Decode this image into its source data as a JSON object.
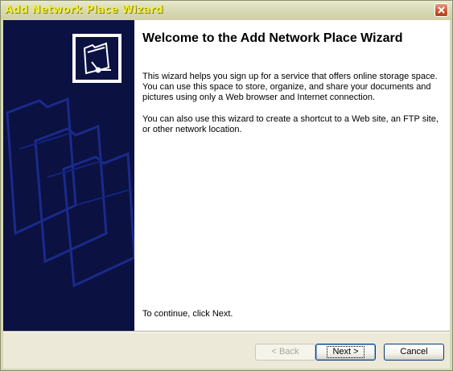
{
  "window": {
    "title": "Add Network Place Wizard",
    "close_icon": "close-icon"
  },
  "header": {
    "wizard_icon": "network-folder-icon",
    "title": "Welcome to the Add Network Place Wizard"
  },
  "body": {
    "paragraph1": "This wizard helps you sign up for a service that offers online storage space. You can use this space to store, organize, and share your documents and pictures using only a Web browser and Internet connection.",
    "paragraph2": "You can also use this wizard to create a shortcut to a Web site, an FTP site, or other network location.",
    "continue_text": "To continue, click Next."
  },
  "buttons": {
    "back": "< Back",
    "next": "Next >",
    "cancel": "Cancel"
  },
  "colors": {
    "title_text": "#f3ef3a",
    "left_panel": "#0b1141",
    "close_button": "#c9512b"
  }
}
